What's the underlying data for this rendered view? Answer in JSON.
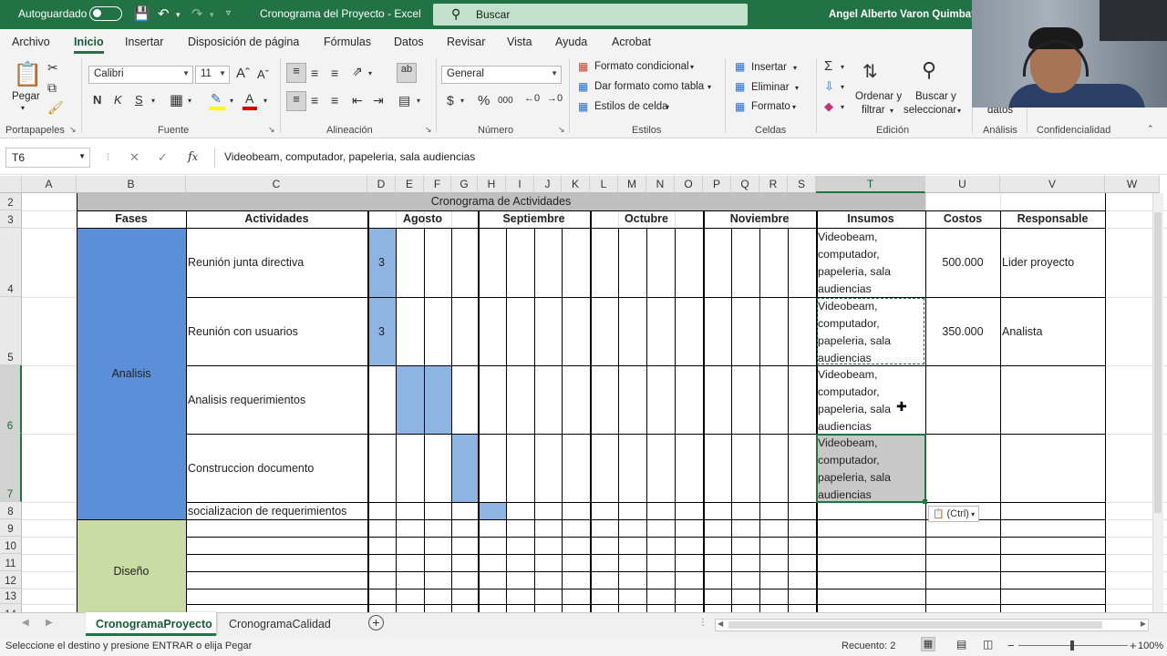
{
  "titlebar": {
    "autosave": "Autoguardado",
    "doc_title": "Cronograma del Proyecto  -  Excel",
    "search_placeholder": "Buscar",
    "user": "Angel Alberto Varon Quimbayo"
  },
  "menu": {
    "tabs": [
      "Archivo",
      "Inicio",
      "Insertar",
      "Disposición de página",
      "Fórmulas",
      "Datos",
      "Revisar",
      "Vista",
      "Ayuda",
      "Acrobat"
    ],
    "active": "Inicio"
  },
  "ribbon": {
    "clipboard": {
      "paste": "Pegar",
      "label": "Portapapeles"
    },
    "font": {
      "name": "Calibri",
      "size": "11",
      "label": "Fuente"
    },
    "alignment": {
      "label": "Alineación"
    },
    "number": {
      "format": "General",
      "label": "Número",
      "percent": "%",
      "thousands": "000"
    },
    "styles": {
      "conditional": "Formato condicional",
      "as_table": "Dar formato como tabla",
      "cell_styles": "Estilos de celda",
      "label": "Estilos"
    },
    "cells": {
      "insert": "Insertar",
      "delete": "Eliminar",
      "format": "Formato",
      "label": "Celdas"
    },
    "editing": {
      "sort_line1": "Ordenar y",
      "sort_line2": "filtrar",
      "find_line1": "Buscar y",
      "find_line2": "seleccionar",
      "label": "Edición"
    },
    "analysis": {
      "data": "datos",
      "label": "Análisis"
    },
    "confidentiality": {
      "label": "Confidencialidad"
    }
  },
  "formula_bar": {
    "name_box": "T6",
    "formula": "Videobeam, computador, papeleria, sala audiencias"
  },
  "columns": [
    "A",
    "B",
    "C",
    "D",
    "E",
    "F",
    "G",
    "H",
    "I",
    "J",
    "K",
    "L",
    "M",
    "N",
    "O",
    "P",
    "Q",
    "R",
    "S",
    "T",
    "U",
    "V",
    "W"
  ],
  "rows": [
    "2",
    "3",
    "4",
    "5",
    "6",
    "7",
    "8",
    "9",
    "10",
    "11",
    "12",
    "13",
    "14"
  ],
  "sheet": {
    "title": "Cronograma de Actividades",
    "headers": {
      "fases": "Fases",
      "actividades": "Actividades",
      "months": [
        "Agosto",
        "Septiembre",
        "Octubre",
        "Noviembre"
      ],
      "insumos": "Insumos",
      "costos": "Costos",
      "responsable": "Responsable"
    },
    "phases": [
      {
        "name": "Analisis",
        "color": "#5b8fd8"
      },
      {
        "name": "Diseño",
        "color": "#c9dca3"
      }
    ],
    "activities": [
      {
        "actividad": "Reunión junta directiva",
        "duracion": "3",
        "insumos": [
          "Videobeam,",
          "computador,",
          "papeleria, sala",
          "audiencias"
        ],
        "costo": "500.000",
        "responsable": "Lider proyecto"
      },
      {
        "actividad": "Reunión con usuarios",
        "duracion": "3",
        "insumos": [
          "Videobeam,",
          "computador,",
          "papeleria, sala",
          "audiencias"
        ],
        "costo": "350.000",
        "responsable": "Analista"
      },
      {
        "actividad": "Analisis requerimientos",
        "duracion": "",
        "insumos": [
          "Videobeam,",
          "computador,",
          "papeleria, sala",
          "audiencias"
        ],
        "costo": "",
        "responsable": ""
      },
      {
        "actividad": "Construccion documento",
        "duracion": "",
        "insumos": [
          "Videobeam,",
          "computador,",
          "papeleria, sala",
          "audiencias"
        ],
        "costo": "",
        "responsable": ""
      },
      {
        "actividad": "socializacion de requerimientos",
        "duracion": "",
        "insumos": [],
        "costo": "",
        "responsable": ""
      }
    ],
    "gantt_color": "#8db4e2",
    "paste_options": "(Ctrl)"
  },
  "sheet_tabs": [
    "CronogramaProyecto",
    "CronogramaCalidad"
  ],
  "active_sheet": "CronogramaProyecto",
  "status": {
    "message": "Seleccione el destino y presione ENTRAR o elija Pegar",
    "count": "Recuento: 2",
    "zoom": "100%"
  },
  "colors": {
    "excel_green": "#217346",
    "header_gray": "#bfbfbf",
    "selection_gray": "#c8c8c8"
  }
}
